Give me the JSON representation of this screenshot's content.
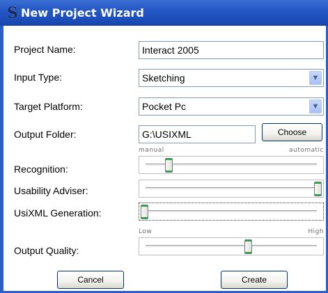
{
  "window": {
    "title": "New Project Wizard",
    "icon": "app-s-logo-icon"
  },
  "fields": {
    "project_name": {
      "label": "Project Name:",
      "value": "Interact 2005"
    },
    "input_type": {
      "label": "Input Type:",
      "value": "Sketching"
    },
    "target_platform": {
      "label": "Target Platform:",
      "value": "Pocket Pc"
    },
    "output_folder": {
      "label": "Output Folder:",
      "value": "G:\\USIXML",
      "button": "Choose"
    }
  },
  "sliders": {
    "recognition": {
      "label": "Recognition:",
      "min_label": "manual",
      "max_label": "automatic",
      "value": 0.14
    },
    "usability_adviser": {
      "label": "Usability Adviser:",
      "value": 1.0
    },
    "usixml_generation": {
      "label": "UsiXML Generation:",
      "value": 0.0
    },
    "output_quality": {
      "label": "Output Quality:",
      "min_label": "Low",
      "max_label": "High",
      "value": 0.6
    }
  },
  "buttons": {
    "cancel": "Cancel",
    "create": "Create"
  },
  "colors": {
    "titlebar": "#2457c5",
    "thumb_accent": "#2fa33b",
    "field_border": "#7f9db9"
  }
}
